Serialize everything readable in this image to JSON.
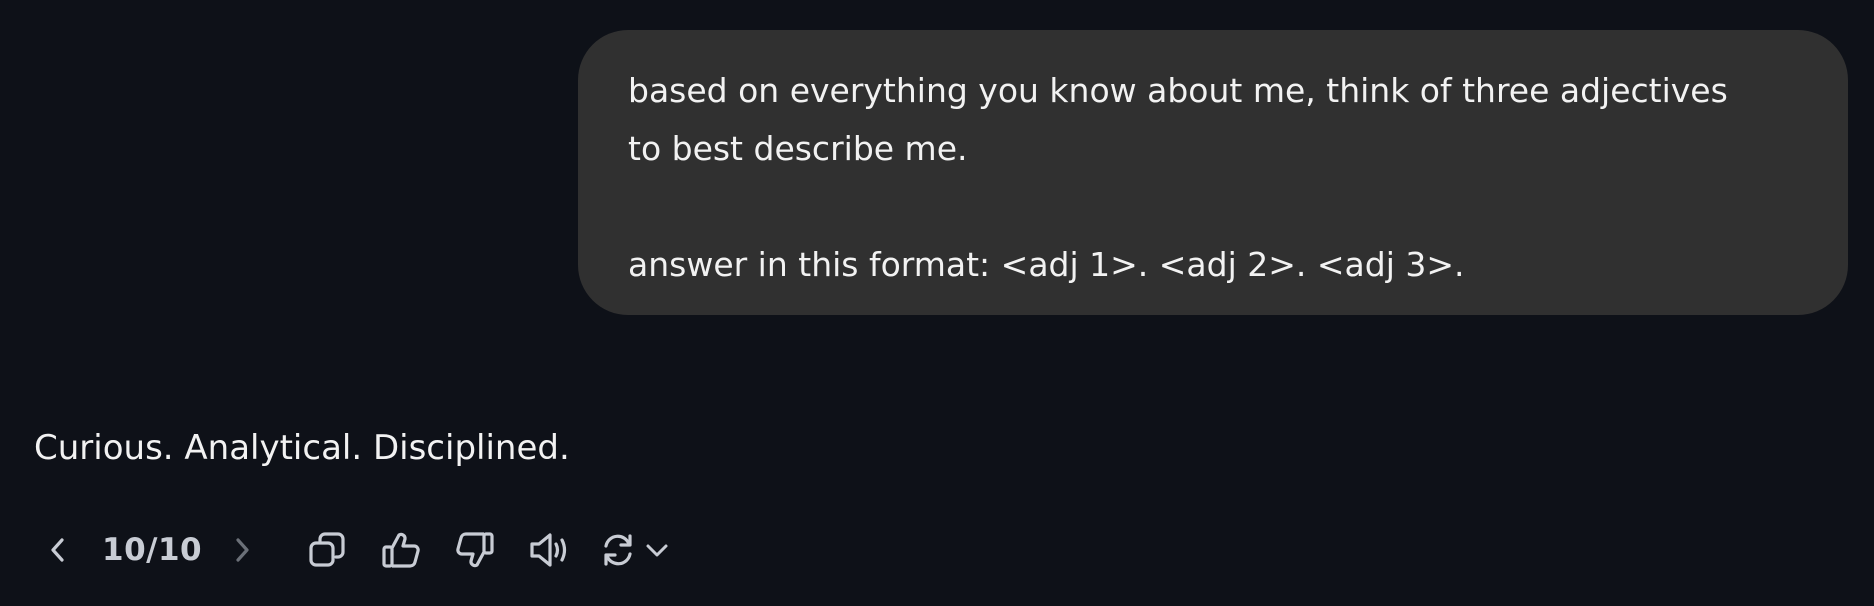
{
  "user_message": {
    "lines": [
      "based on everything you know about me, think of three adjectives",
      "to best describe me.",
      "",
      "answer in this format: <adj 1>. <adj 2>. <adj 3>."
    ]
  },
  "assistant_message": {
    "text": "Curious. Analytical. Disciplined."
  },
  "toolbar": {
    "counter": "10/10",
    "icons": [
      "chevron-left-icon",
      "chevron-right-icon",
      "copy-icon",
      "thumbs-up-icon",
      "thumbs-down-icon",
      "speaker-icon",
      "refresh-icon",
      "chevron-down-icon"
    ]
  },
  "colors": {
    "background": "#0e1118",
    "bubble": "#303030",
    "text": "#f2f2f2",
    "icon": "#c8ccd4",
    "icon_disabled": "#6b7078"
  }
}
